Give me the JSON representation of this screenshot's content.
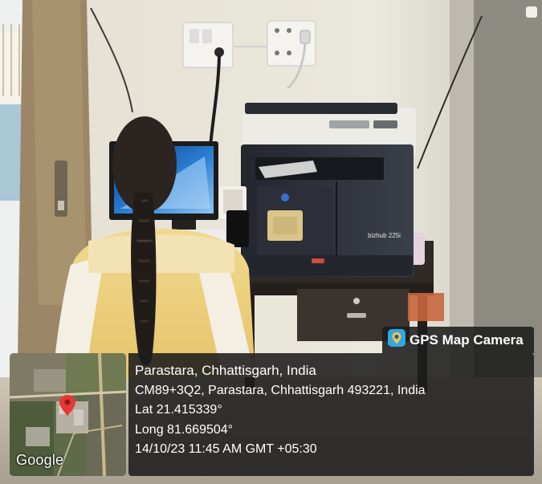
{
  "photo": {
    "description_icon": "gps-camera-pin-icon"
  },
  "stamp": {
    "app_label": "GPS Map Camera",
    "map_provider": "Google",
    "place": "Parastara, Chhattisgarh, India",
    "address": "CM89+3Q2, Parastara, Chhattisgarh 493221, India",
    "latitude": "Lat 21.415339°",
    "longitude": "Long 81.669504°",
    "datetime": "14/10/23 11:45 AM GMT +05:30"
  },
  "device": {
    "copier_brand": "bizhub 225i"
  },
  "colors": {
    "overlay_bg": "#1c1c1c",
    "pin_red": "#e53935"
  }
}
